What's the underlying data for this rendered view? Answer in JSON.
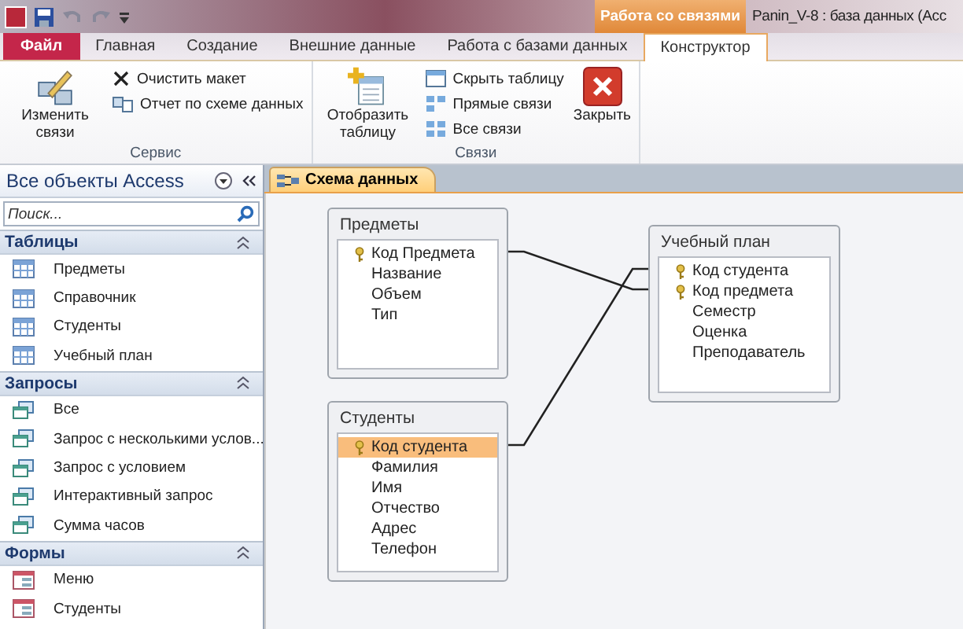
{
  "title_bar": {
    "title": "Panin_V-8 : база данных (Acc",
    "context_tab": "Работа со связями"
  },
  "tabs": [
    {
      "label": "Файл",
      "kind": "file",
      "selected": false
    },
    {
      "label": "Главная",
      "kind": "normal",
      "selected": false
    },
    {
      "label": "Создание",
      "kind": "normal",
      "selected": false
    },
    {
      "label": "Внешние данные",
      "kind": "normal",
      "selected": false
    },
    {
      "label": "Работа с базами данных",
      "kind": "normal",
      "selected": false
    },
    {
      "label": "Конструктор",
      "kind": "context",
      "selected": true
    }
  ],
  "ribbon_groups": [
    {
      "label": "Сервис",
      "buttons": [
        {
          "label": "Изменить связи",
          "kind": "large"
        },
        {
          "label": "Очистить макет",
          "kind": "small"
        },
        {
          "label": "Отчет по схеме данных",
          "kind": "small"
        }
      ]
    },
    {
      "label": "Связи",
      "buttons": [
        {
          "label": "Отобразить таблицу",
          "kind": "large"
        },
        {
          "label": "Скрыть таблицу",
          "kind": "small"
        },
        {
          "label": "Прямые связи",
          "kind": "small"
        },
        {
          "label": "Все связи",
          "kind": "small"
        },
        {
          "label": "Закрыть",
          "kind": "large"
        }
      ]
    }
  ],
  "nav_pane": {
    "title": "Все объекты Access",
    "search": {
      "placeholder": "Поиск..."
    },
    "groups": [
      {
        "title": "Таблицы",
        "kind": "table",
        "items": [
          "Предметы",
          "Справочник",
          "Студенты",
          "Учебный план"
        ]
      },
      {
        "title": "Запросы",
        "kind": "query",
        "items": [
          "Все",
          "Запрос с несколькими услов...",
          "Запрос с условием",
          "Интерактивный запрос",
          "Сумма часов"
        ]
      },
      {
        "title": "Формы",
        "kind": "form",
        "items": [
          "Меню",
          "Студенты"
        ]
      }
    ]
  },
  "document_tab": {
    "label": "Схема данных",
    "selected": true
  },
  "diagram": {
    "tables": [
      {
        "title": "Предметы",
        "fields": [
          {
            "name": "Код Предмета",
            "key": true,
            "selected": false
          },
          {
            "name": "Название",
            "key": false,
            "selected": false
          },
          {
            "name": "Объем",
            "key": false,
            "selected": false
          },
          {
            "name": "Тип",
            "key": false,
            "selected": false
          }
        ]
      },
      {
        "title": "Учебный план",
        "fields": [
          {
            "name": "Код студента",
            "key": true,
            "selected": false
          },
          {
            "name": "Код предмета",
            "key": true,
            "selected": false
          },
          {
            "name": "Семестр",
            "key": false,
            "selected": false
          },
          {
            "name": "Оценка",
            "key": false,
            "selected": false
          },
          {
            "name": "Преподаватель",
            "key": false,
            "selected": false
          }
        ]
      },
      {
        "title": "Студенты",
        "fields": [
          {
            "name": "Код студента",
            "key": true,
            "selected": true
          },
          {
            "name": "Фамилия",
            "key": false,
            "selected": false
          },
          {
            "name": "Имя",
            "key": false,
            "selected": false
          },
          {
            "name": "Отчество",
            "key": false,
            "selected": false
          },
          {
            "name": "Адрес",
            "key": false,
            "selected": false
          },
          {
            "name": "Телефон",
            "key": false,
            "selected": false
          }
        ]
      }
    ]
  }
}
